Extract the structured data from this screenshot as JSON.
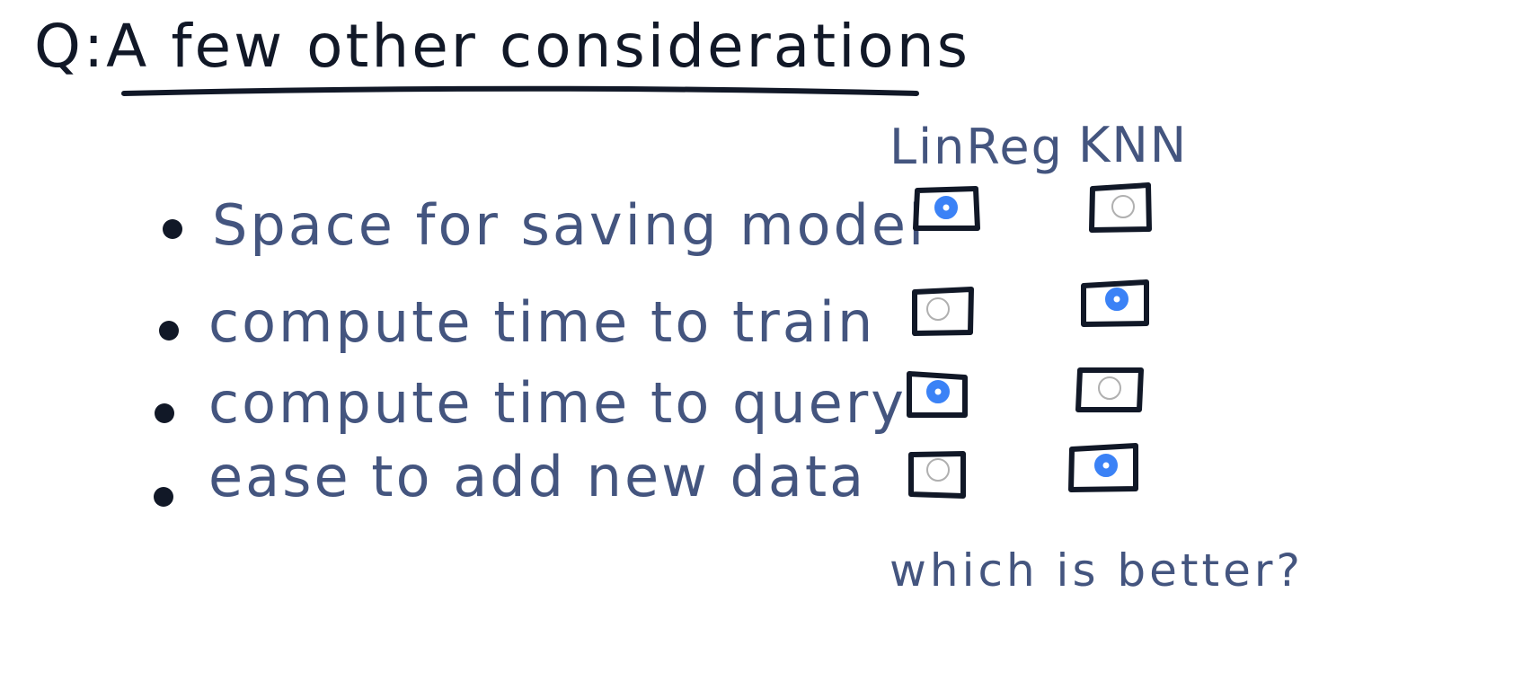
{
  "title": "Q:A few other considerations",
  "columns": {
    "linreg": "LinReg",
    "knn": "KNN"
  },
  "items": [
    {
      "label": "Space for saving model",
      "selected": "linreg"
    },
    {
      "label": "compute time to train",
      "selected": "knn"
    },
    {
      "label": "compute time to query",
      "selected": "linreg"
    },
    {
      "label": "ease to add new data",
      "selected": "knn"
    }
  ],
  "footer": "which is better?",
  "colors": {
    "ink_dark": "#111827",
    "ink_blue": "#44557f",
    "radio_selected": "#3b82f6",
    "radio_unselected": "#b0b0b0"
  }
}
